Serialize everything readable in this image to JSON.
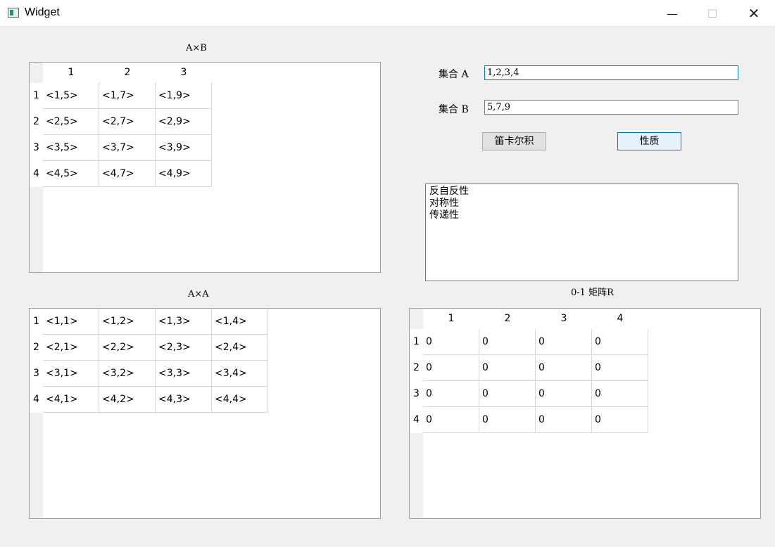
{
  "window": {
    "title": "Widget",
    "min_glyph": "—",
    "max_glyph": "☐",
    "close_glyph": "✕"
  },
  "captions": {
    "axb": "A×B",
    "axa": "A×A",
    "matrix": "0-1 矩阵R"
  },
  "axb_table": {
    "columns": [
      "1",
      "2",
      "3"
    ],
    "rows": [
      "1",
      "2",
      "3",
      "4"
    ],
    "cells": [
      [
        "<1,5>",
        "<1,7>",
        "<1,9>"
      ],
      [
        "<2,5>",
        "<2,7>",
        "<2,9>"
      ],
      [
        "<3,5>",
        "<3,7>",
        "<3,9>"
      ],
      [
        "<4,5>",
        "<4,7>",
        "<4,9>"
      ]
    ]
  },
  "axa_table": {
    "rows": [
      "1",
      "2",
      "3",
      "4"
    ],
    "cells": [
      [
        "<1,1>",
        "<1,2>",
        "<1,3>",
        "<1,4>"
      ],
      [
        "<2,1>",
        "<2,2>",
        "<2,3>",
        "<2,4>"
      ],
      [
        "<3,1>",
        "<3,2>",
        "<3,3>",
        "<3,4>"
      ],
      [
        "<4,1>",
        "<4,2>",
        "<4,3>",
        "<4,4>"
      ]
    ]
  },
  "matrix_table": {
    "columns": [
      "1",
      "2",
      "3",
      "4"
    ],
    "rows": [
      "1",
      "2",
      "3",
      "4"
    ],
    "cells": [
      [
        "0",
        "0",
        "0",
        "0"
      ],
      [
        "0",
        "0",
        "0",
        "0"
      ],
      [
        "0",
        "0",
        "0",
        "0"
      ],
      [
        "0",
        "0",
        "0",
        "0"
      ]
    ]
  },
  "form": {
    "set_a_label": "集合 A",
    "set_a_value": "1,2,3,4",
    "set_b_label": "集合 B",
    "set_b_value": "5,7,9",
    "cartesian_button": "笛卡尔积",
    "property_button": "性质"
  },
  "properties": [
    "反自反性",
    "对称性",
    "传递性"
  ]
}
